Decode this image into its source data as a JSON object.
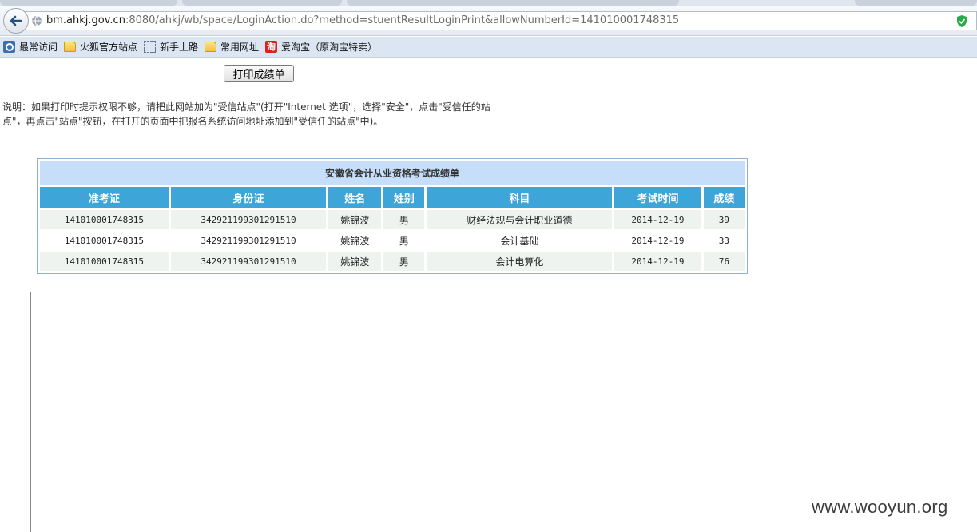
{
  "browser": {
    "url_host": "bm.ahkj.gov.cn",
    "url_rest": ":8080/ahkj/wb/space/LoginAction.do?method=stuentResultLoginPrint&allowNumberId=141010001748315"
  },
  "bookmarks": [
    {
      "label": "最常访问",
      "icon": "most-visited-icon"
    },
    {
      "label": "火狐官方站点",
      "icon": "folder-icon"
    },
    {
      "label": "新手上路",
      "icon": "dashed-box-icon"
    },
    {
      "label": "常用网址",
      "icon": "folder-icon"
    },
    {
      "label": "爱淘宝（原淘宝特卖）",
      "icon": "taobao-icon",
      "icon_text": "淘"
    }
  ],
  "page": {
    "print_button": "打印成绩单",
    "note": "说明：如果打印时提示权限不够，请把此网站加为\"受信站点\"(打开\"Internet 选项\"，选择\"安全\"，点击\"受信任的站点\"，再点击\"站点\"按钮，在打开的页面中把报名系统访问地址添加到\"受信任的站点\"中)。"
  },
  "score_table": {
    "title": "安徽省会计从业资格考试成绩单",
    "headers": [
      "准考证",
      "身份证",
      "姓名",
      "姓别",
      "科目",
      "考试时间",
      "成绩"
    ],
    "rows": [
      [
        "141010001748315",
        "342921199301291510",
        "姚锦波",
        "男",
        "财经法规与会计职业道德",
        "2014-12-19",
        "39"
      ],
      [
        "141010001748315",
        "342921199301291510",
        "姚锦波",
        "男",
        "会计基础",
        "2014-12-19",
        "33"
      ],
      [
        "141010001748315",
        "342921199301291510",
        "姚锦波",
        "男",
        "会计电算化",
        "2014-12-19",
        "76"
      ]
    ]
  },
  "watermark": "www.wooyun.org",
  "colors": {
    "header_bg": "#3ea5d8",
    "title_bg": "#c6defa",
    "bookmarks_bg": "#dbe6f2"
  }
}
